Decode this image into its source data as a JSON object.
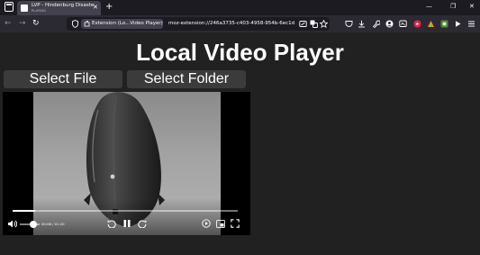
{
  "browser": {
    "tab": {
      "title": "LVP - Hindenburg Disaster Wi",
      "status": "PLAYING",
      "favicon": "film-icon"
    },
    "window_controls": [
      "minimize-icon",
      "restore-icon",
      "close-icon"
    ],
    "url": {
      "identity_label": "Extension (Lo...Video Player)",
      "text": "moz-extension://246a3735-c403-4958-954b-6ec1d45dcf..."
    },
    "accent_colors": {
      "red_badge": "#e22850",
      "toolbar_bg": "#2b2a33",
      "tab_active": "#42414d"
    }
  },
  "page": {
    "title": "Local Video Player",
    "select_file_label": "Select File",
    "select_folder_label": "Select Folder"
  },
  "player": {
    "time": "00:08 / 01:20",
    "progress_fraction": 0.1,
    "volume_fraction": 0.7,
    "state": "playing"
  }
}
